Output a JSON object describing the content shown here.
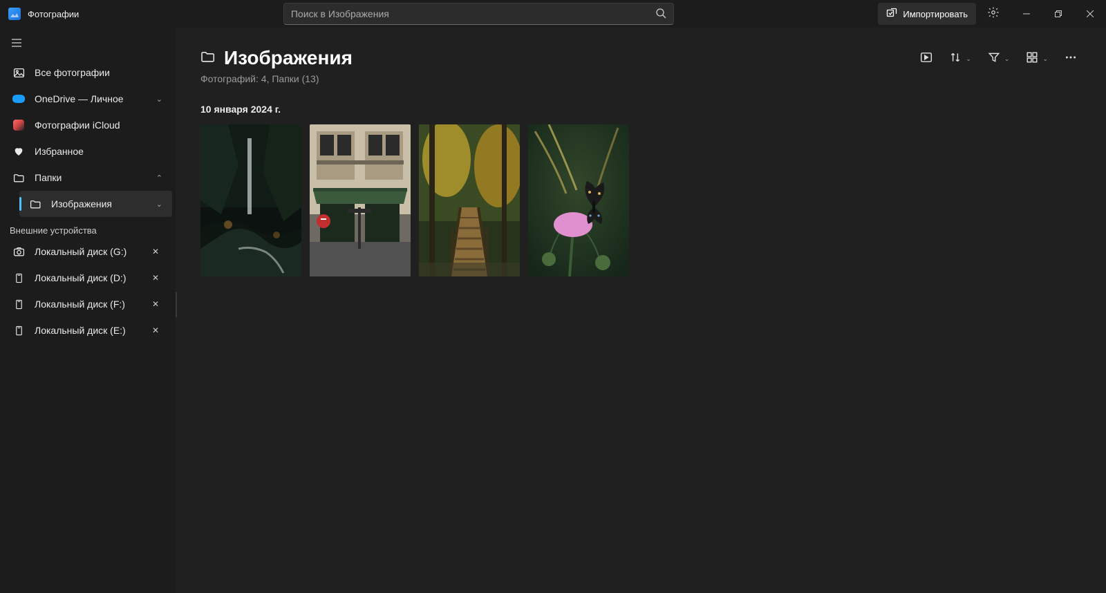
{
  "app": {
    "title": "Фотографии"
  },
  "search": {
    "placeholder": "Поиск в Изображения"
  },
  "import_label": "Импортировать",
  "sidebar": {
    "all_photos": "Все фотографии",
    "onedrive": "OneDrive — Личное",
    "icloud": "Фотографии iCloud",
    "favorites": "Избранное",
    "folders_label": "Папки",
    "images_folder": "Изображения",
    "external_header": "Внешние устройства",
    "drives": [
      "Локальный диск (G:)",
      "Локальный диск (D:)",
      "Локальный диск (F:)",
      "Локальный диск (E:)"
    ]
  },
  "main": {
    "title": "Изображения",
    "subtitle": "Фотографий: 4, Папки (13)",
    "group_date": "10 января 2024 г."
  }
}
